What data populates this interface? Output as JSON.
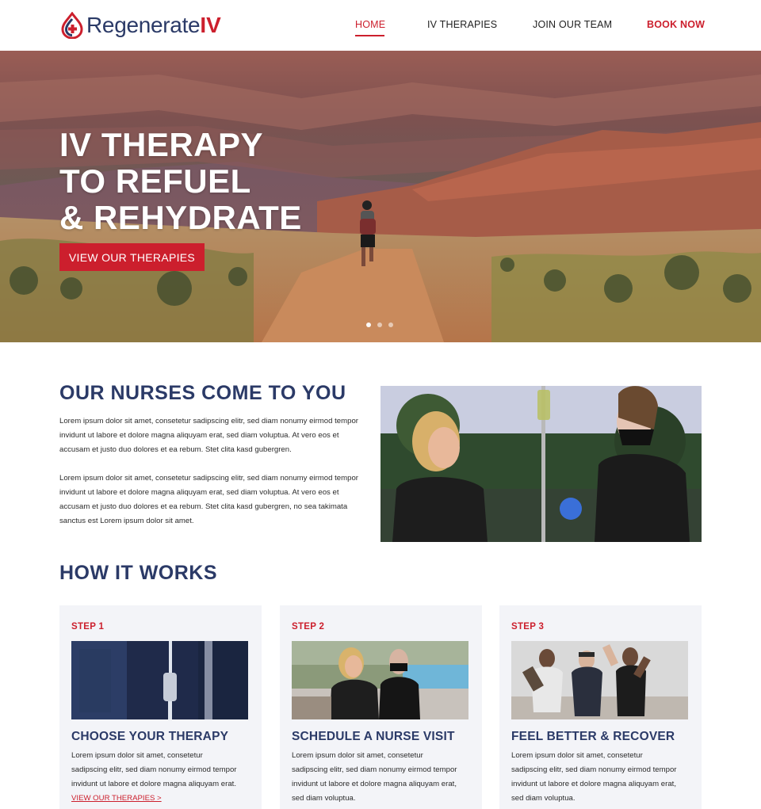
{
  "brand": {
    "name_main": "Regenerate",
    "name_accent": "IV",
    "primary_color": "#2b3a67",
    "accent_color": "#cc1f2d"
  },
  "nav": {
    "home": "HOME",
    "therapies": "IV THERAPIES",
    "team": "JOIN OUR TEAM",
    "book": "BOOK NOW"
  },
  "hero": {
    "title_line1": "IV THERAPY",
    "title_line2": "TO REFUEL",
    "title_line3": "& REHYDRATE",
    "button": "VIEW OUR THERAPIES"
  },
  "nurses": {
    "title": "OUR NURSES COME TO YOU",
    "para1": "Lorem ipsum dolor sit amet, consetetur sadipscing elitr, sed diam nonumy eirmod tempor invidunt ut labore et dolore magna aliquyam erat, sed diam voluptua. At vero eos et accusam et justo duo dolores et ea rebum. Stet clita kasd gubergren.",
    "para2": "Lorem ipsum dolor sit amet, consetetur sadipscing elitr, sed diam nonumy eirmod tempor invidunt ut labore et dolore magna aliquyam erat, sed diam voluptua. At vero eos et accusam et justo duo dolores et ea rebum. Stet clita kasd gubergren, no sea takimata sanctus est Lorem ipsum dolor sit amet."
  },
  "how": {
    "title": "HOW IT WORKS",
    "steps": [
      {
        "step": "STEP 1",
        "title": "CHOOSE YOUR THERAPY",
        "text": "Lorem ipsum dolor sit amet, consetetur sadipscing elitr, sed diam nonumy eirmod tempor invidunt ut labore et dolore magna aliquyam erat.",
        "link": "VIEW OUR THERAPIES >"
      },
      {
        "step": "STEP 2",
        "title": "SCHEDULE A NURSE VISIT",
        "text": "Lorem ipsum dolor sit amet, consetetur sadipscing elitr, sed diam nonumy eirmod tempor invidunt ut labore et dolore magna aliquyam erat, sed diam voluptua."
      },
      {
        "step": "STEP 3",
        "title": "FEEL BETTER & RECOVER",
        "text": "Lorem ipsum dolor sit amet, consetetur sadipscing elitr, sed diam nonumy eirmod tempor invidunt ut labore et dolore magna aliquyam erat, sed diam voluptua."
      }
    ]
  }
}
